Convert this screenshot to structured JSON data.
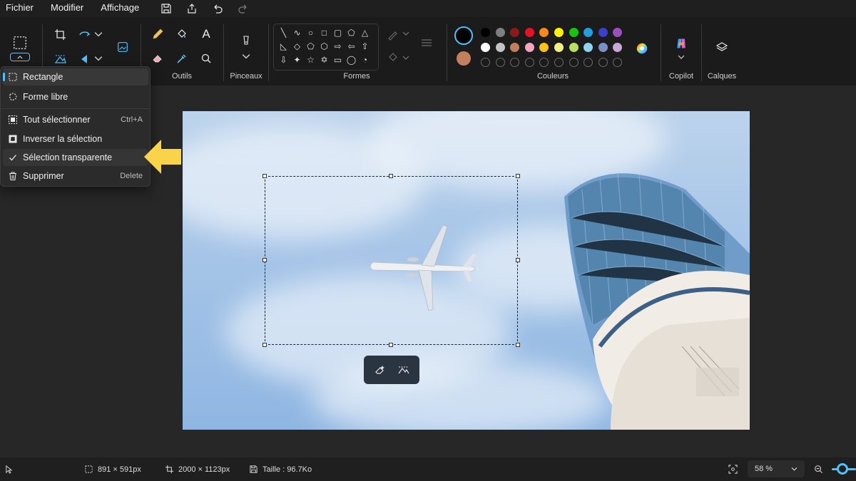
{
  "menubar": {
    "items": [
      "Fichier",
      "Modifier",
      "Affichage"
    ]
  },
  "ribbon": {
    "groups": {
      "tools": "Outils",
      "brushes": "Pinceaux",
      "shapes": "Formes",
      "colors": "Couleurs",
      "copilot": "Copilot",
      "layers": "Calques"
    },
    "text_tool_glyph": "A",
    "shapes": [
      "╲",
      "∿",
      "○",
      "□",
      "▢",
      "⬠",
      "△",
      "◺",
      "◇",
      "⬠",
      "⬡",
      "⇨",
      "⇦",
      "⇧",
      "⇩",
      "✦",
      "☆",
      "✡",
      "▭",
      "◯",
      "◔"
    ],
    "current_colors": {
      "primary": "#000000",
      "secondary": "#c2805e"
    },
    "palette": [
      "#000000",
      "#7f7f7f",
      "#8b1a1a",
      "#e81123",
      "#f7861b",
      "#fff100",
      "#16c60c",
      "#1f9fe0",
      "#3a3fd1",
      "#9b4fbf",
      "#ffffff",
      "#c3c3c3",
      "#c07f5a",
      "#f4a6c0",
      "#f8c21a",
      "#f2ee88",
      "#b5e061",
      "#8fd3f0",
      "#7b8fc8",
      "#c8a6d8"
    ]
  },
  "dropdown": {
    "items": [
      {
        "label": "Rectangle",
        "icon": "rect-select-icon",
        "shortcut": ""
      },
      {
        "label": "Forme libre",
        "icon": "freeform-select-icon",
        "shortcut": ""
      },
      {
        "label": "Tout sélectionner",
        "icon": "select-all-icon",
        "shortcut": "Ctrl+A"
      },
      {
        "label": "Inverser la sélection",
        "icon": "invert-selection-icon",
        "shortcut": ""
      },
      {
        "label": "Sélection transparente",
        "icon": "checkmark-icon",
        "shortcut": ""
      },
      {
        "label": "Supprimer",
        "icon": "trash-icon",
        "shortcut": "Delete"
      }
    ]
  },
  "status": {
    "selection_size": "891 × 591px",
    "canvas_size": "2000 × 1123px",
    "file_size": "Taille : 96.7Ko",
    "zoom": "58 %"
  },
  "colors": {
    "accent": "#4cc2ff",
    "arrow": "#f9d448"
  }
}
